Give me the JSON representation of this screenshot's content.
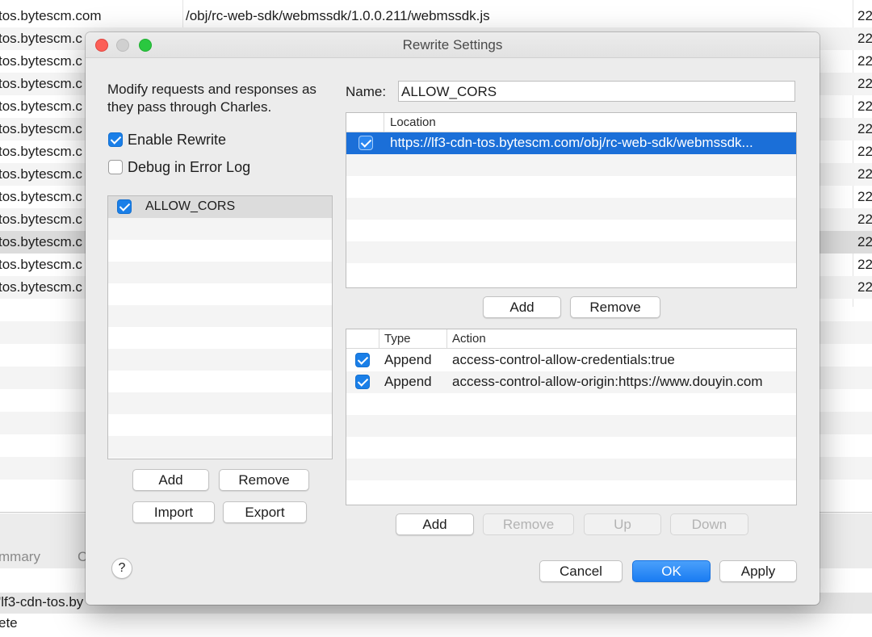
{
  "background": {
    "rows": [
      {
        "host": "tos.bytescm.com",
        "path": "/obj/rc-web-sdk/webmssdk/1.0.0.211/webmssdk.js",
        "num": "22"
      },
      {
        "host": "tos.bytescm.c",
        "path": "",
        "num": "22"
      },
      {
        "host": "tos.bytescm.c",
        "path": "",
        "num": "22"
      },
      {
        "host": "tos.bytescm.c",
        "path": "",
        "num": "22"
      },
      {
        "host": "tos.bytescm.c",
        "path": "",
        "num": "22"
      },
      {
        "host": "tos.bytescm.c",
        "path": "",
        "num": "22"
      },
      {
        "host": "tos.bytescm.c",
        "path": "",
        "num": "22"
      },
      {
        "host": "tos.bytescm.c",
        "path": "",
        "num": "22"
      },
      {
        "host": "tos.bytescm.c",
        "path": "",
        "num": "22"
      },
      {
        "host": "tos.bytescm.c",
        "path": "",
        "num": "22"
      },
      {
        "host": "tos.bytescm.c",
        "path": "",
        "num": "22"
      },
      {
        "host": "tos.bytescm.c",
        "path": "",
        "num": "22"
      },
      {
        "host": "tos.bytescm.c",
        "path": "",
        "num": "22"
      }
    ],
    "tab_summary": "mmary",
    "tab_other": "C",
    "line1": "'lf3-cdn-tos.by",
    "line2": "ete"
  },
  "dialog": {
    "title": "Rewrite Settings",
    "description": "Modify requests and responses as they pass through Charles.",
    "enable_rewrite": {
      "label": "Enable Rewrite",
      "checked": true
    },
    "debug_error_log": {
      "label": "Debug in Error Log",
      "checked": false
    },
    "sets": [
      {
        "name": "ALLOW_CORS",
        "checked": true
      }
    ],
    "sets_buttons": {
      "add": "Add",
      "remove": "Remove",
      "import": "Import",
      "export": "Export"
    },
    "name_label": "Name:",
    "name_value": "ALLOW_CORS",
    "locations": {
      "header": "Location",
      "rows": [
        {
          "checked": true,
          "location": "https://lf3-cdn-tos.bytescm.com/obj/rc-web-sdk/webmssdk..."
        }
      ],
      "add": "Add",
      "remove": "Remove"
    },
    "rules": {
      "header_type": "Type",
      "header_action": "Action",
      "rows": [
        {
          "checked": true,
          "type": "Append",
          "action": "access-control-allow-credentials:true"
        },
        {
          "checked": true,
          "type": "Append",
          "action": "access-control-allow-origin:https://www.douyin.com"
        }
      ],
      "add": "Add",
      "remove": "Remove",
      "up": "Up",
      "down": "Down"
    },
    "help": "?",
    "cancel": "Cancel",
    "ok": "OK",
    "apply": "Apply"
  },
  "colors": {
    "selection": "#1b6fd8",
    "accent": "#1a7cf2",
    "close": "#fc5f57",
    "minimize": "#d0d0d0",
    "zoom": "#2ac840"
  }
}
